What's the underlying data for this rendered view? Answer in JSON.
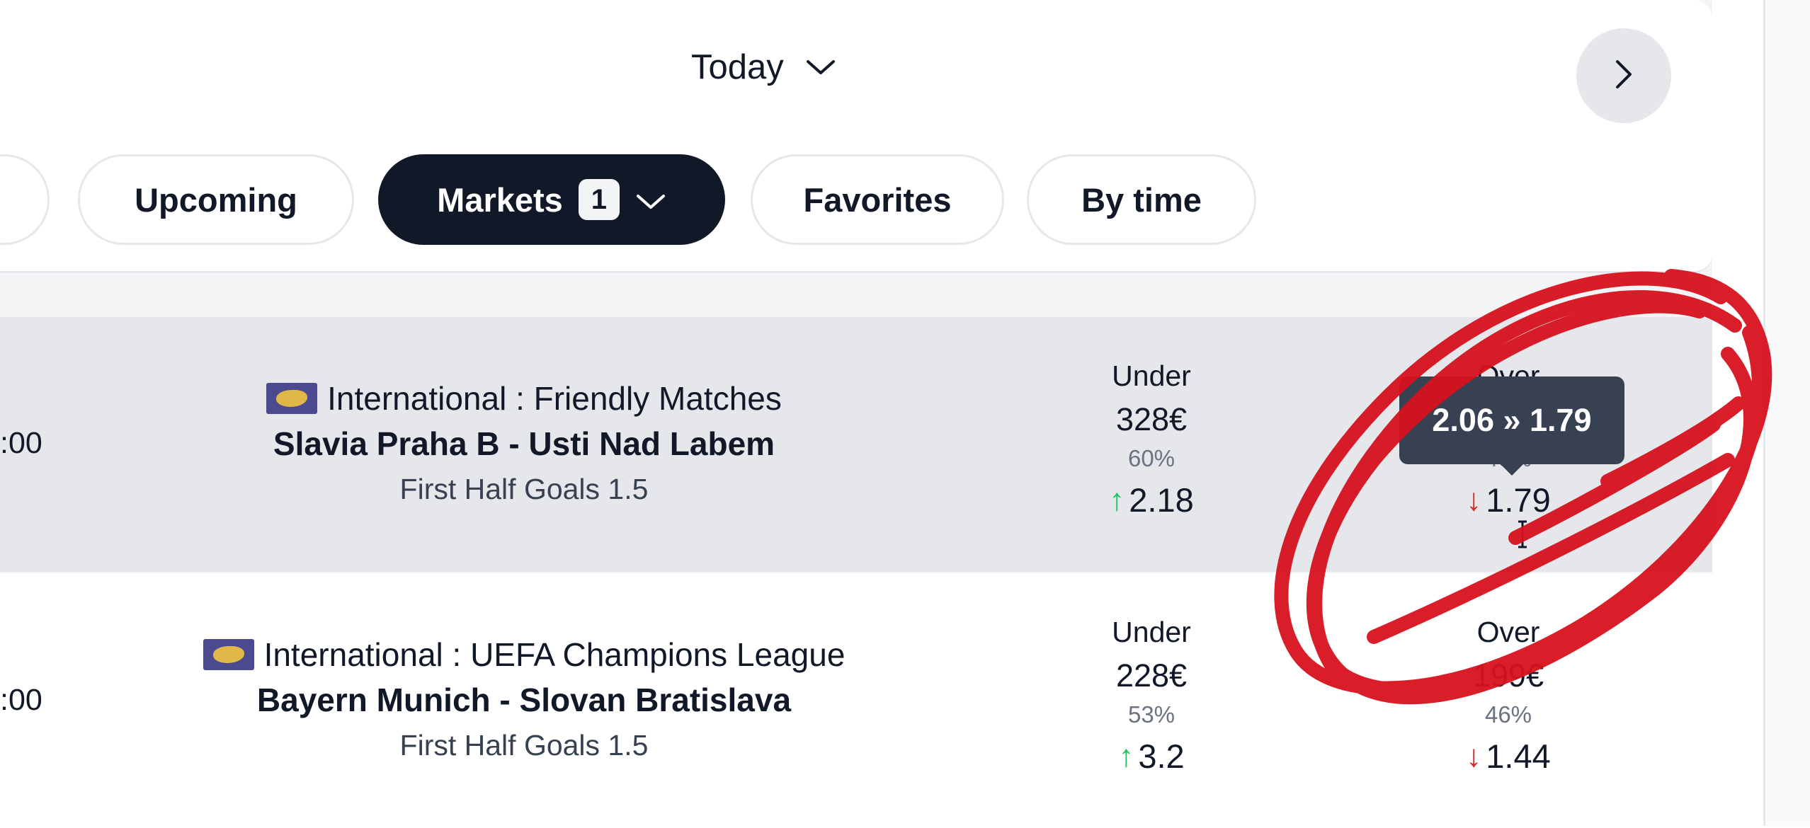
{
  "header": {
    "date_label": "Today",
    "next_button_icon": "chevron-right-icon"
  },
  "filters": [
    {
      "label": "Upcoming",
      "active": false
    },
    {
      "label": "Markets",
      "badge": "1",
      "active": true
    },
    {
      "label": "Favorites",
      "active": false
    },
    {
      "label": "By time",
      "active": false
    }
  ],
  "matches": [
    {
      "time": ":00",
      "league": "International : Friendly Matches",
      "teams": "Slavia Praha B - Usti Nad Labem",
      "market": "First Half Goals 1.5",
      "under": {
        "label": "Under",
        "amount": "328€",
        "pct": "60%",
        "odds": "2.18",
        "trend": "up"
      },
      "over": {
        "label": "Over",
        "amount": "",
        "pct": "40%",
        "odds": "1.79",
        "trend": "down"
      }
    },
    {
      "time": ":00",
      "league": "International : UEFA Champions League",
      "teams": "Bayern Munich - Slovan Bratislava",
      "market": "First Half Goals 1.5",
      "under": {
        "label": "Under",
        "amount": "228€",
        "pct": "53%",
        "odds": "3.2",
        "trend": "up"
      },
      "over": {
        "label": "Over",
        "amount": "199€",
        "pct": "46%",
        "odds": "1.44",
        "trend": "down"
      }
    }
  ],
  "tooltip": {
    "text": "2.06 » 1.79"
  },
  "colors": {
    "active_pill": "#111827",
    "up_arrow": "#22c55e",
    "down_arrow": "#dc2626",
    "annotation": "#d7121f",
    "tooltip_bg": "#374151"
  }
}
